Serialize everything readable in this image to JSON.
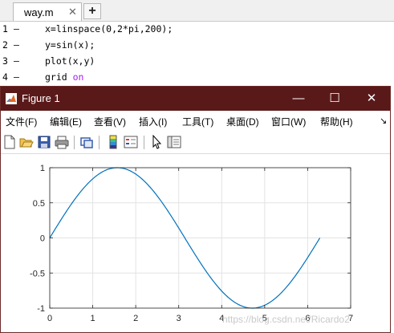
{
  "editor": {
    "tab_label": "way.m",
    "tab_close": "✕",
    "add_tab": "+",
    "lines": [
      {
        "no": "1",
        "dash": "–",
        "code": "x=linspace(0,2*pi,200);",
        "keyword": ""
      },
      {
        "no": "2",
        "dash": "–",
        "code": "y=sin(x);",
        "keyword": ""
      },
      {
        "no": "3",
        "dash": "–",
        "code": "plot(x,y)",
        "keyword": ""
      },
      {
        "no": "4",
        "dash": "–",
        "code": "grid ",
        "keyword": "on"
      }
    ]
  },
  "figure": {
    "title": "Figure 1",
    "minimize": "—",
    "maximize": "☐",
    "close": "✕",
    "menu": [
      "文件(F)",
      "编辑(E)",
      "查看(V)",
      "插入(I)",
      "工具(T)",
      "桌面(D)",
      "窗口(W)",
      "帮助(H)"
    ],
    "menu_overflow": "↘",
    "toolbar_icons": [
      "new-figure-icon",
      "open-file-icon",
      "save-icon",
      "print-icon",
      "link-plot-icon",
      "colorbar-icon",
      "legend-icon",
      "pointer-icon",
      "property-editor-icon"
    ]
  },
  "chart_data": {
    "type": "line",
    "title": "",
    "xlabel": "",
    "ylabel": "",
    "function": "y = sin(x)",
    "x_range": [
      0,
      6.283185307179586
    ],
    "points": 200,
    "xlim": [
      0,
      7
    ],
    "ylim": [
      -1,
      1
    ],
    "xticks": [
      0,
      1,
      2,
      3,
      4,
      5,
      6,
      7
    ],
    "yticks": [
      -1,
      -0.5,
      0,
      0.5,
      1
    ],
    "xtick_labels": [
      "0",
      "1",
      "2",
      "3",
      "4",
      "5",
      "6",
      "7"
    ],
    "ytick_labels": [
      "-1",
      "-0.5",
      "0",
      "0.5",
      "1"
    ],
    "grid": true,
    "line_color": "#0072bd"
  },
  "watermark": "https://blog.csdn.net/Ricardo2"
}
